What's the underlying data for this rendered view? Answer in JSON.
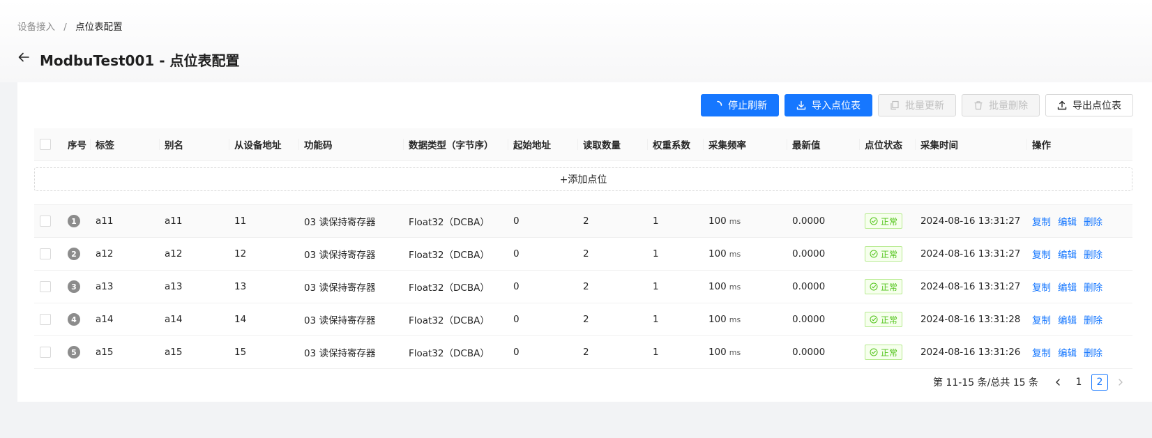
{
  "breadcrumb": {
    "parent": "设备接入",
    "separator": "/",
    "current": "点位表配置"
  },
  "page_title": "ModbuTest001 - 点位表配置",
  "toolbar": {
    "stop_refresh": "停止刷新",
    "import_points": "导入点位表",
    "batch_update": "批量更新",
    "batch_delete": "批量删除",
    "export_points": "导出点位表"
  },
  "table": {
    "headers": [
      "序号",
      "标签",
      "别名",
      "从设备地址",
      "功能码",
      "数据类型（字节序）",
      "起始地址",
      "读取数量",
      "权重系数",
      "采集频率",
      "最新值",
      "点位状态",
      "采集时间",
      "操作"
    ],
    "add_label": "+添加点位",
    "rows": [
      {
        "index": "1",
        "tag": "a11",
        "alias": "a11",
        "slave": "11",
        "func": "03 读保持寄存器",
        "dtype": "Float32（DCBA）",
        "start": "0",
        "count": "2",
        "weight": "1",
        "freq": "100",
        "unit": "ms",
        "value": "0.0000",
        "status": "正常",
        "time": "2024-08-16 13:31:27"
      },
      {
        "index": "2",
        "tag": "a12",
        "alias": "a12",
        "slave": "12",
        "func": "03 读保持寄存器",
        "dtype": "Float32（DCBA）",
        "start": "0",
        "count": "2",
        "weight": "1",
        "freq": "100",
        "unit": "ms",
        "value": "0.0000",
        "status": "正常",
        "time": "2024-08-16 13:31:27"
      },
      {
        "index": "3",
        "tag": "a13",
        "alias": "a13",
        "slave": "13",
        "func": "03 读保持寄存器",
        "dtype": "Float32（DCBA）",
        "start": "0",
        "count": "2",
        "weight": "1",
        "freq": "100",
        "unit": "ms",
        "value": "0.0000",
        "status": "正常",
        "time": "2024-08-16 13:31:27"
      },
      {
        "index": "4",
        "tag": "a14",
        "alias": "a14",
        "slave": "14",
        "func": "03 读保持寄存器",
        "dtype": "Float32（DCBA）",
        "start": "0",
        "count": "2",
        "weight": "1",
        "freq": "100",
        "unit": "ms",
        "value": "0.0000",
        "status": "正常",
        "time": "2024-08-16 13:31:28"
      },
      {
        "index": "5",
        "tag": "a15",
        "alias": "a15",
        "slave": "15",
        "func": "03 读保持寄存器",
        "dtype": "Float32（DCBA）",
        "start": "0",
        "count": "2",
        "weight": "1",
        "freq": "100",
        "unit": "ms",
        "value": "0.0000",
        "status": "正常",
        "time": "2024-08-16 13:31:26"
      }
    ],
    "actions": {
      "copy": "复制",
      "edit": "编辑",
      "delete": "删除"
    }
  },
  "pagination": {
    "total_text": "第 11-15 条/总共 15 条",
    "pages": [
      "1",
      "2"
    ],
    "current_page": "2"
  },
  "colors": {
    "primary": "#1677ff",
    "success": "#52c41a",
    "disabled": "#bfbfbf"
  }
}
